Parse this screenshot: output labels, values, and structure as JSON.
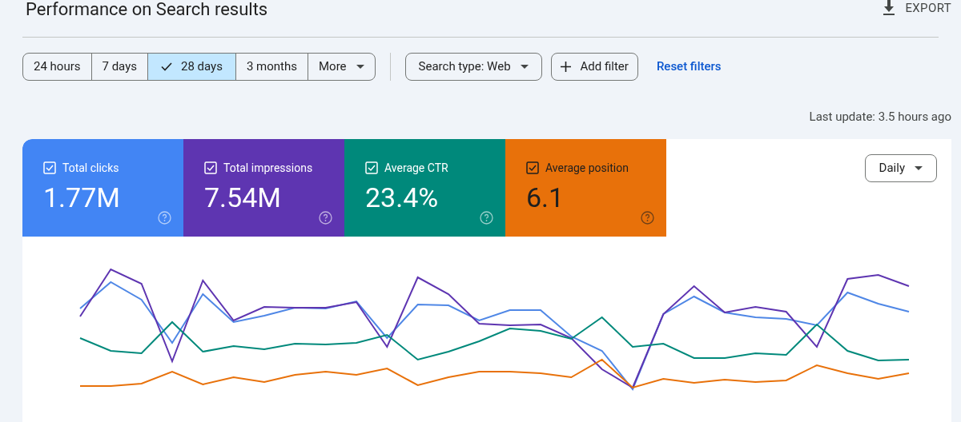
{
  "header": {
    "title": "Performance on Search results",
    "export_label": "EXPORT"
  },
  "date_ranges": [
    {
      "label": "24 hours",
      "selected": false
    },
    {
      "label": "7 days",
      "selected": false
    },
    {
      "label": "28 days",
      "selected": true
    },
    {
      "label": "3 months",
      "selected": false
    },
    {
      "label": "More",
      "selected": false
    }
  ],
  "filters": {
    "search_type": "Search type: Web",
    "add_filter": "Add filter",
    "reset": "Reset filters"
  },
  "last_update": "Last update: 3.5 hours ago",
  "metrics": [
    {
      "label": "Total clicks",
      "value": "1.77M",
      "checked": true,
      "color": "#4285f4",
      "kind": "light"
    },
    {
      "label": "Total impressions",
      "value": "7.54M",
      "checked": true,
      "color": "#5e35b1",
      "kind": "light"
    },
    {
      "label": "Average CTR",
      "value": "23.4%",
      "checked": true,
      "color": "#00897b",
      "kind": "light"
    },
    {
      "label": "Average position",
      "value": "6.1",
      "checked": true,
      "color": "#e8710a",
      "kind": "dark"
    }
  ],
  "granularity": "Daily"
}
